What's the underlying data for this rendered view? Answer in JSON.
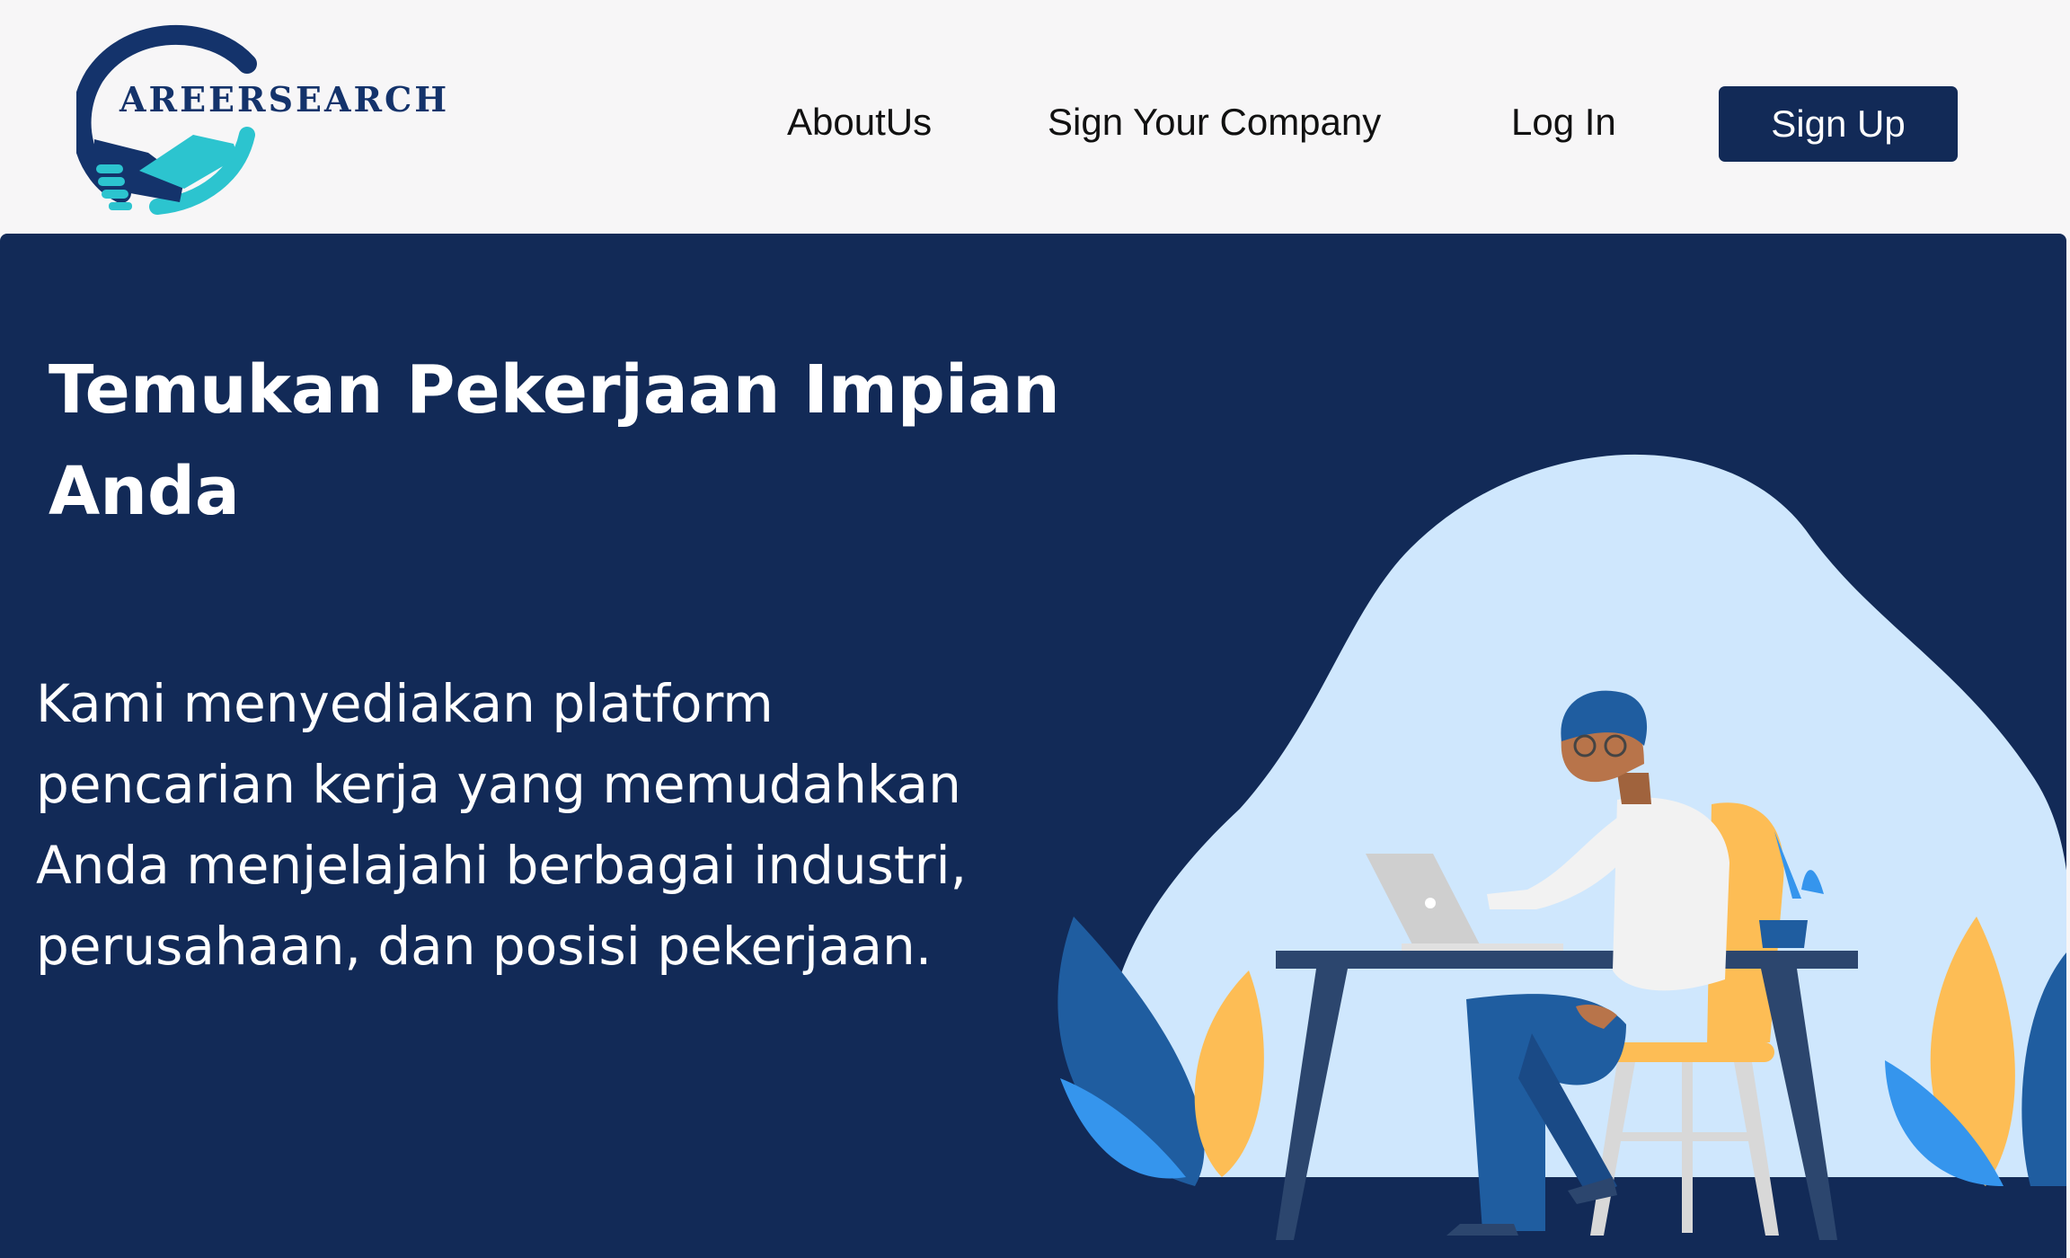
{
  "brand": {
    "name": "AREERSEARCH",
    "colors": {
      "navy": "#122a57",
      "logo_blue": "#14336b",
      "teal": "#2cc4cf"
    }
  },
  "nav": {
    "links": [
      {
        "label": "AboutUs"
      },
      {
        "label": "Sign Your Company"
      },
      {
        "label": "Log In"
      }
    ],
    "signup_label": "Sign Up"
  },
  "hero": {
    "title_line1": "Temukan Pekerjaan Impian",
    "title_line2": "Anda",
    "description_lines": [
      "Kami menyediakan platform",
      "pencarian kerja yang memudahkan",
      "Anda menjelajahi berbagai industri,",
      "perusahaan, dan posisi pekerjaan."
    ]
  },
  "illustration": {
    "icons": [
      "person-at-desk-icon",
      "laptop-icon",
      "plant-icon",
      "leaf-icon"
    ],
    "colors": {
      "blob": "#cfe7fd",
      "yellow": "#fdbd55",
      "blue": "#1f5da0",
      "light_blue": "#3595ed"
    }
  }
}
